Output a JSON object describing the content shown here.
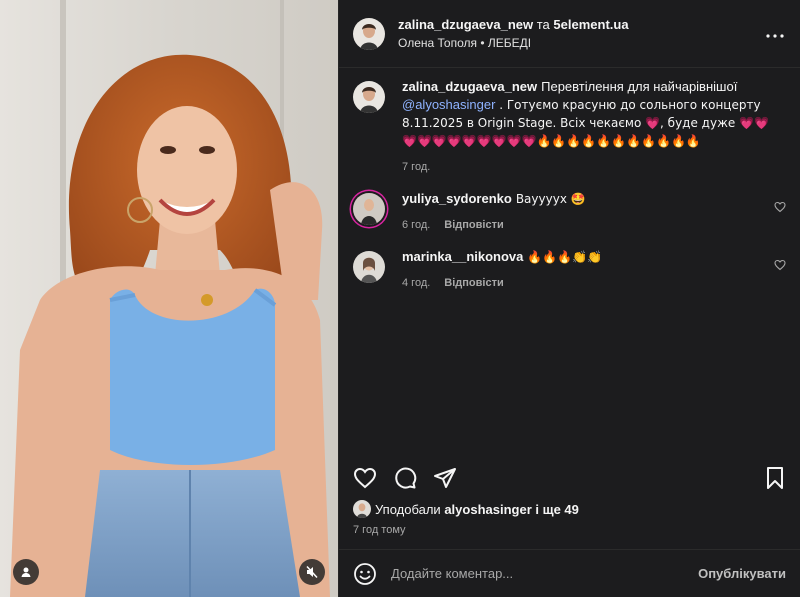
{
  "header": {
    "author": "zalina_dzugaeva_new",
    "conjunction": "та",
    "collaborator": "5element.ua",
    "audio_artist": "Олена Тополя",
    "separator": "•",
    "audio_track": "ЛЕБЕДІ"
  },
  "caption": {
    "user": "zalina_dzugaeva_new",
    "text_before": "Перевтілення для найчарівнішої ",
    "mention": "@alyoshasinger",
    "text_after": " . Готуємо красуню до сольного концерту 8.11.2025 в Origin Stage. Всіх чекаємо 💗, буде дуже 💗💗💗💗💗💗💗💗💗💗💗🔥🔥🔥🔥🔥🔥🔥🔥🔥🔥🔥",
    "time": "7 год."
  },
  "comments": [
    {
      "user": "yuliya_sydorenko",
      "text": "Вауууух 🤩",
      "time": "6 год.",
      "reply": "Відповісти"
    },
    {
      "user": "marinka__nikonova",
      "text": "🔥🔥🔥👏👏",
      "time": "4 год.",
      "reply": "Відповісти"
    }
  ],
  "likes": {
    "prefix": "Уподобали",
    "user": "alyoshasinger",
    "suffix": "і ще 49"
  },
  "post_time": "7 год тому",
  "composer": {
    "placeholder": "Додайте коментар...",
    "post_label": "Опублікувати"
  },
  "icons": {
    "more": "more-options-icon",
    "like": "heart-icon",
    "comment": "comment-icon",
    "share": "share-icon",
    "save": "bookmark-icon",
    "emoji": "emoji-icon",
    "mute": "muted-speaker-icon",
    "tagged": "tagged-user-icon"
  },
  "colors": {
    "panel_bg": "#1c1c1e",
    "mention": "#8fb3ff",
    "muted_text": "#a8a8a8"
  }
}
